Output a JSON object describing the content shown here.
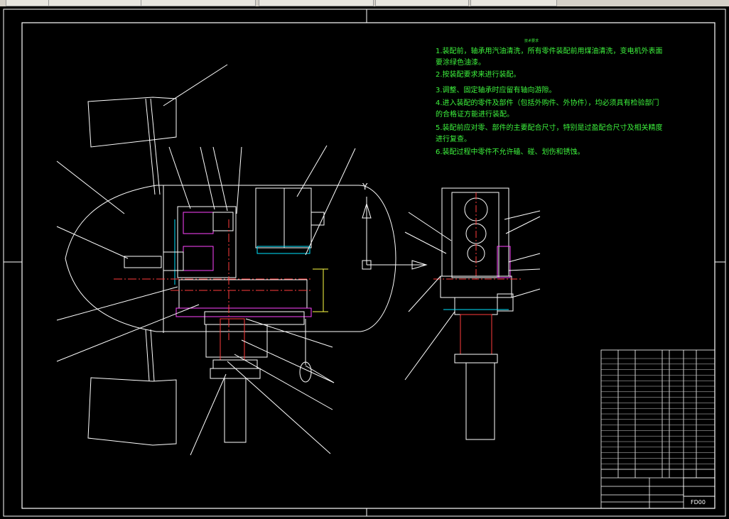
{
  "window": {
    "tabs": [
      "",
      "",
      "",
      "",
      "",
      ""
    ]
  },
  "notes": {
    "heading": "技术要求",
    "lines": [
      "1.装配前，轴承用汽油清洗，所有零件装配前用煤油清洗，变电机外表面",
      "要涂绿色油漆。",
      "2.按装配要求来进行装配。",
      "3.调整、固定轴承时应留有轴向游隙。",
      "4.进入装配的零件及部件（包括外购件、外协件），均必须具有检验部门",
      "的合格证方能进行装配。",
      "5.装配前应对零、部件的主要配合尺寸，特别是过盈配合尺寸及相关精度",
      "进行复查。",
      "6.装配过程中零件不允许磕、碰、划伤和锈蚀。"
    ]
  },
  "drawing": {
    "axis_y_label": "Y",
    "drawing_number": "FD00"
  },
  "colors": {
    "lines": "#ffffff",
    "notes": "#3df23d",
    "center": "#ff3b3b",
    "accent": "#ff44ff",
    "cyan": "#00e5ff",
    "yellow": "#ffff44",
    "magenta": "#ff00ff"
  }
}
